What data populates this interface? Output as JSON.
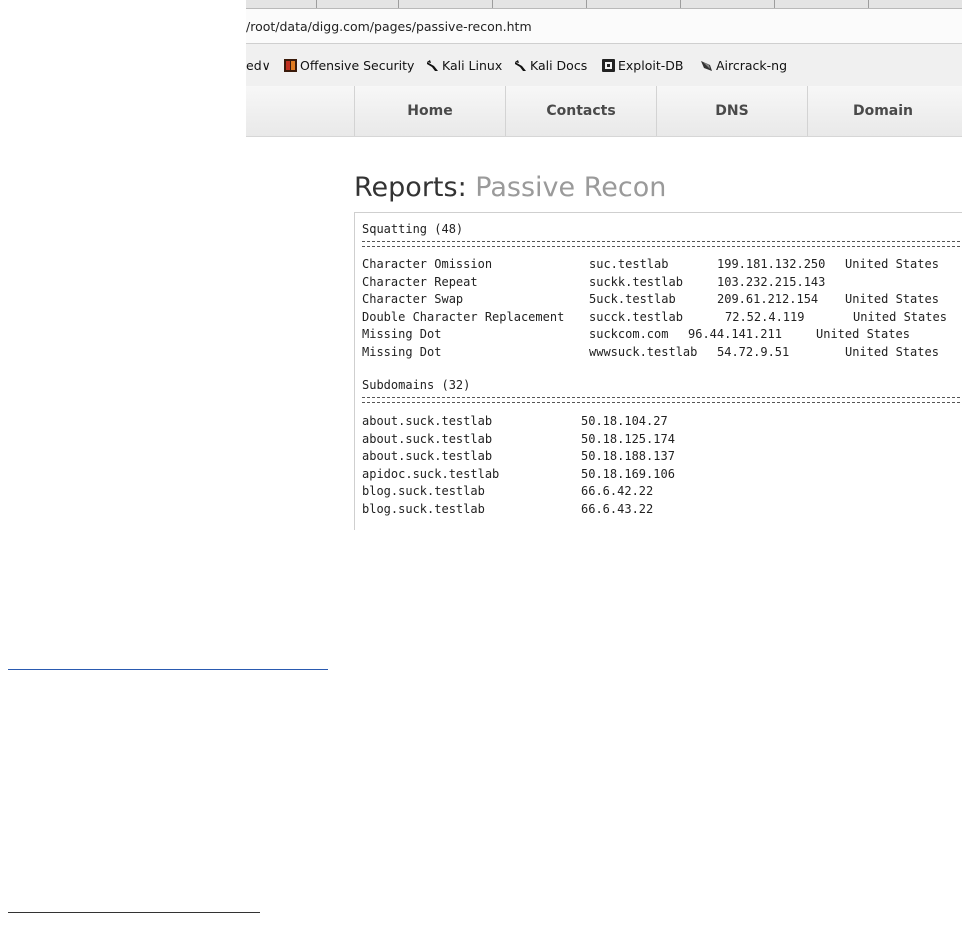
{
  "browser": {
    "url": "/root/data/digg.com/pages/passive-recon.htm",
    "bookmarks": [
      {
        "label": "ed∨",
        "icon": "chevron-down-icon"
      },
      {
        "label": "Offensive Security",
        "icon": "offsec-icon"
      },
      {
        "label": "Kali Linux",
        "icon": "kali-dragon-icon"
      },
      {
        "label": "Kali Docs",
        "icon": "kali-dragon-icon"
      },
      {
        "label": "Exploit-DB",
        "icon": "exploitdb-icon"
      },
      {
        "label": "Aircrack-ng",
        "icon": "aircrack-icon"
      }
    ]
  },
  "nav": {
    "items": [
      "Home",
      "Contacts",
      "DNS",
      "Domain"
    ]
  },
  "page": {
    "title": "Reports:",
    "subtitle": "Passive Recon"
  },
  "squatting": {
    "header": "Squatting (48)",
    "rows": [
      {
        "type": "Character Omission",
        "domain": "suc.testlab",
        "ip": "199.181.132.250",
        "country": "United States"
      },
      {
        "type": "Character Repeat",
        "domain": "suckk.testlab",
        "ip": "103.232.215.143",
        "country": ""
      },
      {
        "type": "Character Swap",
        "domain": "5uck.testlab",
        "ip": "209.61.212.154",
        "country": "United States"
      },
      {
        "type": "Double Character Replacement",
        "domain": "succk.testlab",
        "ip": "72.52.4.119",
        "country": "United States"
      },
      {
        "type": "Missing Dot",
        "domain": "suckcom.com",
        "ip": "96.44.141.211",
        "country": "United States"
      },
      {
        "type": "Missing Dot",
        "domain": "wwwsuck.testlab",
        "ip": "54.72.9.51",
        "country": "United States"
      }
    ]
  },
  "subdomains": {
    "header": "Subdomains (32)",
    "rows": [
      {
        "host": "about.suck.testlab",
        "ip": "50.18.104.27"
      },
      {
        "host": "about.suck.testlab",
        "ip": "50.18.125.174"
      },
      {
        "host": "about.suck.testlab",
        "ip": "50.18.188.137"
      },
      {
        "host": "apidoc.suck.testlab",
        "ip": "50.18.169.106"
      },
      {
        "host": "blog.suck.testlab",
        "ip": "66.6.42.22"
      },
      {
        "host": "blog.suck.testlab",
        "ip": "66.6.43.22"
      }
    ]
  },
  "colors": {
    "link_line": "#2a5ab0",
    "nav_bg": "#efefef",
    "subtitle": "#9a9a9a"
  }
}
